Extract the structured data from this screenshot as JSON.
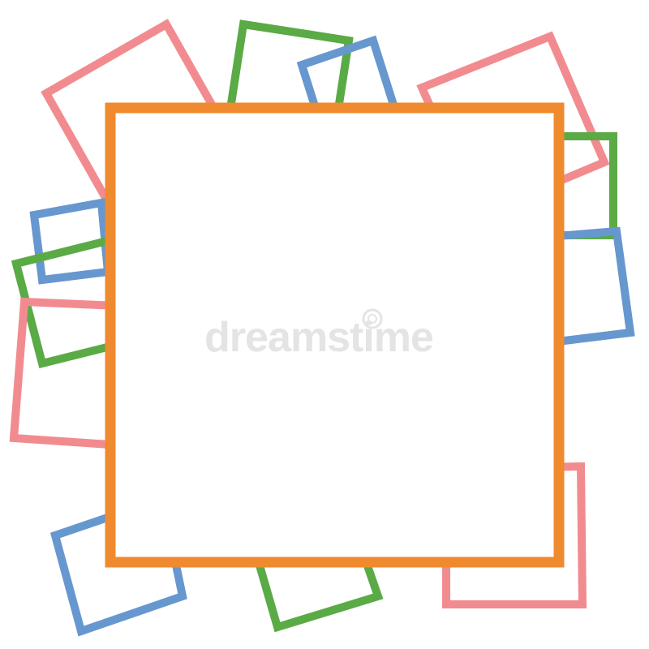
{
  "colors": {
    "background": "#ffffff",
    "pink": "#f28b8f",
    "green": "#5aaa46",
    "blue": "#6797cf",
    "orange": "#f08a2e",
    "watermark": "#e4e4e4"
  },
  "decorative_frames": [
    {
      "name": "pink-frame-top-left",
      "color": "pink"
    },
    {
      "name": "green-frame-top",
      "color": "green"
    },
    {
      "name": "blue-frame-top",
      "color": "blue"
    },
    {
      "name": "pink-frame-top-right",
      "color": "pink"
    },
    {
      "name": "green-frame-right",
      "color": "green"
    },
    {
      "name": "blue-frame-right",
      "color": "blue"
    },
    {
      "name": "blue-frame-left-small",
      "color": "blue"
    },
    {
      "name": "green-frame-left",
      "color": "green"
    },
    {
      "name": "pink-frame-left",
      "color": "pink"
    },
    {
      "name": "blue-frame-bottom-left",
      "color": "blue"
    },
    {
      "name": "green-frame-bottom",
      "color": "green"
    },
    {
      "name": "pink-frame-bottom-right",
      "color": "pink"
    }
  ],
  "main_frame": {
    "color": "orange",
    "fill": "background"
  },
  "watermark": {
    "text": "dreamstime",
    "color": "watermark",
    "icon": "circle-logo-icon"
  }
}
